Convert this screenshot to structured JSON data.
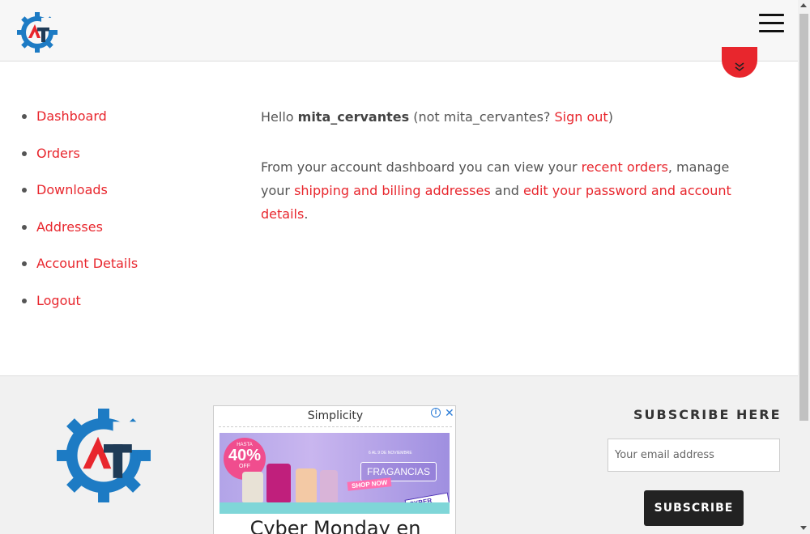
{
  "header": {
    "logo_icon": "at-gear-logo",
    "menu_icon": "hamburger-menu-icon"
  },
  "scroll_button_icon": "double-chevron-down-icon",
  "account_nav": {
    "items": [
      {
        "label": "Dashboard"
      },
      {
        "label": "Orders"
      },
      {
        "label": "Downloads"
      },
      {
        "label": "Addresses"
      },
      {
        "label": "Account Details"
      },
      {
        "label": "Logout"
      }
    ]
  },
  "main": {
    "greeting_hello": "Hello ",
    "username": "mita_cervantes",
    "not_prefix": " (not mita_cervantes? ",
    "sign_out": "Sign out",
    "not_suffix": ")",
    "intro_1": "From your account dashboard you can view your ",
    "recent_orders": "recent orders",
    "intro_2": ", manage your ",
    "shipping_billing": "shipping and billing addresses",
    "intro_3": " and ",
    "edit_password": "edit your password and account details",
    "intro_4": "."
  },
  "footer": {
    "ad": {
      "title": "Simplicity",
      "badge_top": "HASTA",
      "badge_value": "40%",
      "badge_off": "OFF",
      "date_text": "6 AL 9 DE NOVIEMBRE",
      "fragrancias": "FRAGANCIAS",
      "shop_now": "SHOP NOW",
      "cyber_monday": "CYBER MONDAY",
      "headline": "Cyber Monday en"
    },
    "subscribe": {
      "title": "SUBSCRIBE HERE",
      "email_placeholder": "Your email address",
      "button_label": "SUBSCRIBE"
    }
  },
  "colors": {
    "accent": "#e8262d",
    "logo_blue": "#1d7bc4",
    "logo_dark": "#1f3b57",
    "button_dark": "#222222"
  }
}
